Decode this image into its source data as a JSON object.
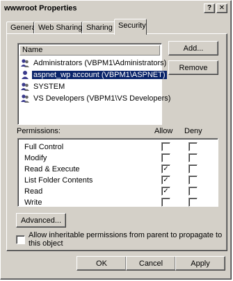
{
  "window": {
    "title": "wwwroot Properties",
    "help_label": "?",
    "close_label": "✕"
  },
  "tabs": [
    {
      "label": "General"
    },
    {
      "label": "Web Sharing"
    },
    {
      "label": "Sharing"
    },
    {
      "label": "Security",
      "active": true
    }
  ],
  "users": {
    "column_header": "Name",
    "items": [
      {
        "label": "Administrators (VBPM1\\Administrators)",
        "icon": "users-group-icon",
        "selected": false
      },
      {
        "label": "aspnet_wp account (VBPM1\\ASPNET)",
        "icon": "user-icon",
        "selected": true
      },
      {
        "label": "SYSTEM",
        "icon": "users-group-icon",
        "selected": false
      },
      {
        "label": "VS Developers (VBPM1\\VS Developers)",
        "icon": "users-group-icon",
        "selected": false
      }
    ],
    "add_label": "Add...",
    "remove_label": "Remove"
  },
  "permissions": {
    "label": "Permissions:",
    "allow_header": "Allow",
    "deny_header": "Deny",
    "items": [
      {
        "label": "Full Control",
        "allow": false,
        "deny": false
      },
      {
        "label": "Modify",
        "allow": false,
        "deny": false
      },
      {
        "label": "Read & Execute",
        "allow": true,
        "deny": false
      },
      {
        "label": "List Folder Contents",
        "allow": true,
        "deny": false
      },
      {
        "label": "Read",
        "allow": true,
        "deny": false
      },
      {
        "label": "Write",
        "allow": false,
        "deny": false
      }
    ]
  },
  "advanced_label": "Advanced...",
  "inherit": {
    "label": "Allow inheritable permissions from parent to propagate to this object",
    "checked": false
  },
  "buttons": {
    "ok": "OK",
    "cancel": "Cancel",
    "apply": "Apply"
  },
  "colors": {
    "selection": "#0a246a",
    "face": "#d4d0c8"
  }
}
